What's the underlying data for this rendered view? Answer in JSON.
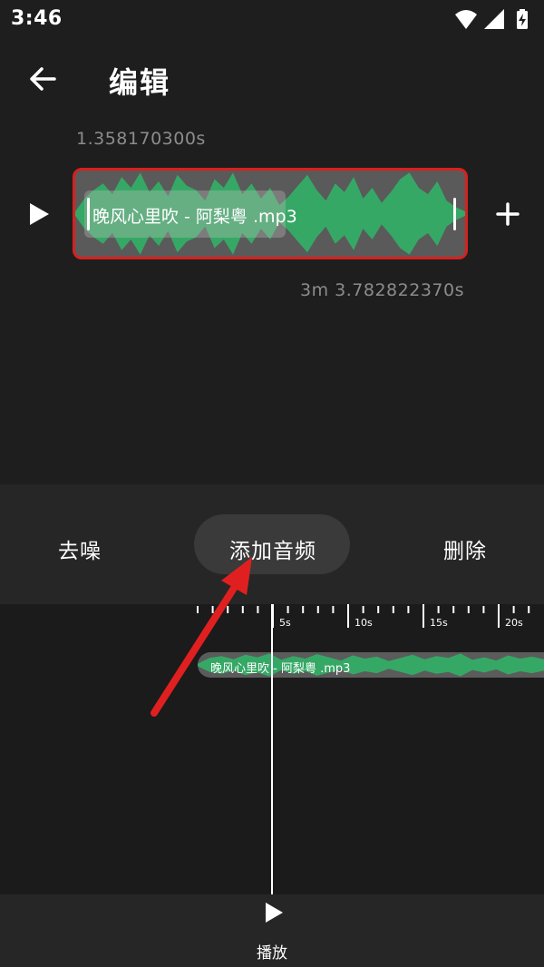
{
  "status_bar": {
    "time": "3:46",
    "icons": [
      "wifi-icon",
      "signal-icon",
      "battery-charging-icon"
    ]
  },
  "header": {
    "title": "编辑",
    "back_icon": "arrow-left-icon"
  },
  "clip_editor": {
    "start_time": "1.358170300s",
    "end_time": "3m 3.782822370s",
    "clip_name": "晚风心里吹 - 阿梨粤 .mp3",
    "play_icon": "play-icon",
    "add_icon": "plus-icon",
    "colors": {
      "selection_border": "#d8201f",
      "waveform": "#36a865"
    }
  },
  "menu": {
    "items": [
      {
        "label": "去噪"
      },
      {
        "label": "添加音频",
        "highlighted": true
      },
      {
        "label": "删除"
      }
    ]
  },
  "timeline": {
    "ticks": [
      "5s",
      "10s",
      "15s",
      "20s"
    ],
    "track_label": "晚风心里吹 - 阿梨粤 .mp3"
  },
  "bottom_bar": {
    "play_label": "播放",
    "play_icon": "play-icon"
  },
  "annotation": {
    "arrow_color": "#e02020",
    "arrow_icon": "red-arrow-icon"
  }
}
